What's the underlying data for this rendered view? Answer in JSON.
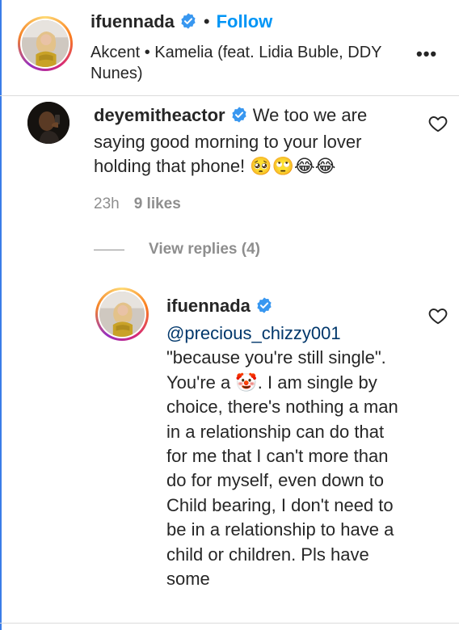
{
  "post": {
    "username": "ifuennada",
    "separator": "•",
    "follow_label": "Follow",
    "song": "Akcent • Kamelia (feat. Lidia Buble, DDY Nunes)",
    "more_label": "•••"
  },
  "comment": {
    "username": "deyemitheactor",
    "text": "We too we are saying good morning to your lover holding that phone! 🥺🙄😂😂",
    "time": "23h",
    "likes": "9 likes"
  },
  "view_replies": "View replies (4)",
  "reply": {
    "username": "ifuennada",
    "mention": "@precious_chizzy001",
    "text_before_emoji": "\"because you're still single\". You're a ",
    "emoji": "🤡",
    "text_after_emoji": ". I am single by choice, there's nothing a man in a relationship can do that for me that I can't more than do for myself, even down to Child bearing, I don't need to be in a relationship to have a child or children. Pls have some"
  },
  "colors": {
    "link_blue": "#0095f6",
    "mention_blue": "#00376b",
    "verified_blue": "#3897f0",
    "secondary_text": "#8e8e8e"
  },
  "icons": {
    "verified": "verified-badge-icon",
    "heart": "heart-outline-icon",
    "more": "more-options-icon"
  }
}
